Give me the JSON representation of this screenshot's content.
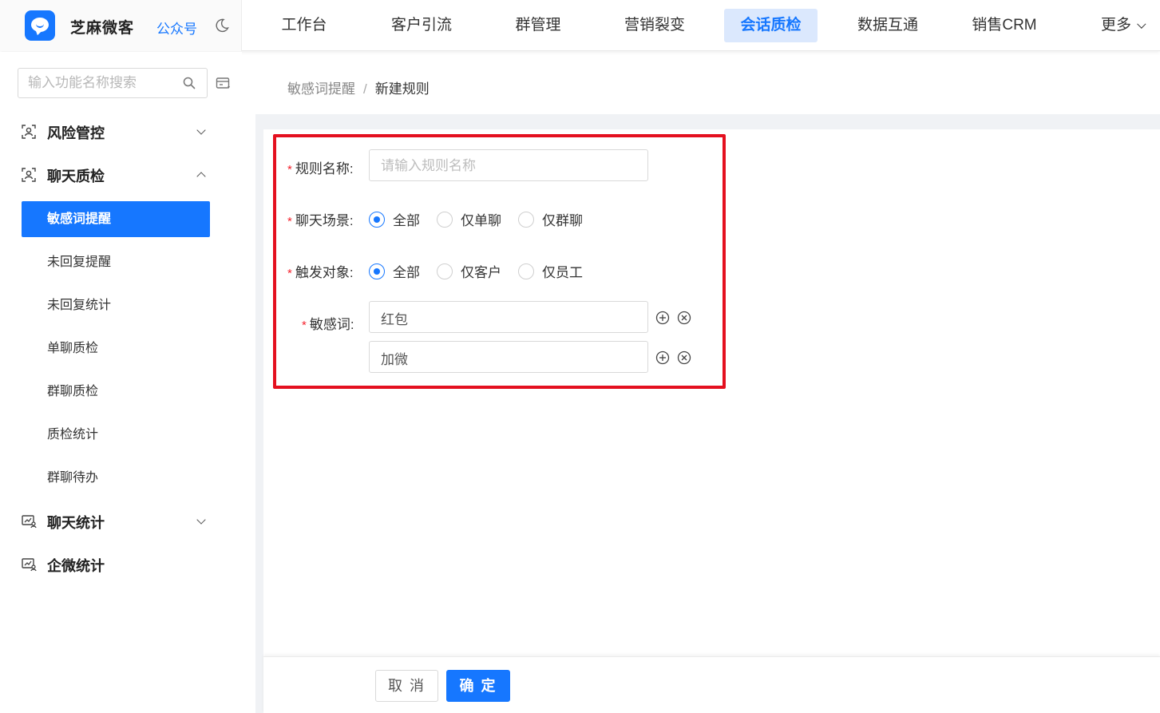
{
  "app": {
    "brand_name": "芝麻微客",
    "brand_link": "公众号",
    "brand_color": "#1677ff"
  },
  "nav": {
    "items": [
      {
        "label": "工作台",
        "active": false
      },
      {
        "label": "客户引流",
        "active": false
      },
      {
        "label": "群管理",
        "active": false
      },
      {
        "label": "营销裂变",
        "active": false
      },
      {
        "label": "会话质检",
        "active": true
      },
      {
        "label": "数据互通",
        "active": false
      },
      {
        "label": "销售CRM",
        "active": false
      },
      {
        "label": "更多",
        "active": false
      }
    ]
  },
  "sidebar": {
    "search_placeholder": "输入功能名称搜索",
    "groups": [
      {
        "label": "风险管控",
        "icon": "user-scan-icon",
        "expanded": false
      },
      {
        "label": "聊天质检",
        "icon": "user-scan-icon",
        "expanded": true
      },
      {
        "label": "聊天统计",
        "icon": "chart-user-icon",
        "expanded": false
      },
      {
        "label": "企微统计",
        "icon": "chart-user-icon",
        "expanded": null
      }
    ],
    "sub_items": [
      {
        "label": "敏感词提醒",
        "active": true
      },
      {
        "label": "未回复提醒",
        "active": false
      },
      {
        "label": "未回复统计",
        "active": false
      },
      {
        "label": "单聊质检",
        "active": false
      },
      {
        "label": "群聊质检",
        "active": false
      },
      {
        "label": "质检统计",
        "active": false
      },
      {
        "label": "群聊待办",
        "active": false
      }
    ]
  },
  "breadcrumb": {
    "parent": "敏感词提醒",
    "separator": "/",
    "current": "新建规则"
  },
  "form": {
    "rule_name": {
      "label": "规则名称:",
      "placeholder": "请输入规则名称",
      "value": ""
    },
    "chat_scene": {
      "label": "聊天场景:",
      "options": [
        {
          "label": "全部",
          "checked": true
        },
        {
          "label": "仅单聊",
          "checked": false
        },
        {
          "label": "仅群聊",
          "checked": false
        }
      ]
    },
    "trigger_target": {
      "label": "触发对象:",
      "options": [
        {
          "label": "全部",
          "checked": true
        },
        {
          "label": "仅客户",
          "checked": false
        },
        {
          "label": "仅员工",
          "checked": false
        }
      ]
    },
    "sensitive_words": {
      "label": "敏感词:",
      "values": [
        "红包",
        "加微"
      ]
    }
  },
  "footer": {
    "cancel_label": "取 消",
    "confirm_label": "确 定"
  },
  "colors": {
    "primary": "#1677ff",
    "highlight_border": "#e4101f",
    "required_mark": "#f5222d"
  }
}
